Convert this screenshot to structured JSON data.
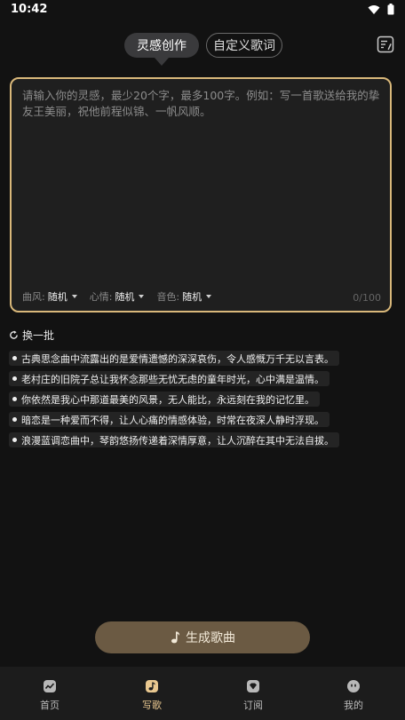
{
  "status_bar": {
    "time": "10:42"
  },
  "tabs": [
    {
      "label": "灵感创作",
      "active": true
    },
    {
      "label": "自定义歌词",
      "active": false
    }
  ],
  "editor": {
    "placeholder": "请输入你的灵感，最少20个字，最多100字。例如：写一首歌送给我的挚友王美丽，祝他前程似锦、一帆风顺。",
    "value": "",
    "char_count": "0/100",
    "options": [
      {
        "label": "曲风:",
        "value": "随机"
      },
      {
        "label": "心情:",
        "value": "随机"
      },
      {
        "label": "音色:",
        "value": "随机"
      }
    ]
  },
  "refresh_label": "换一批",
  "suggestions": [
    "古典思念曲中流露出的是爱情遗憾的深深哀伤，令人感慨万千无以言表。",
    "老村庄的旧院子总让我怀念那些无忧无虑的童年时光，心中满是温情。",
    "你依然是我心中那道最美的风景，无人能比，永远刻在我的记忆里。",
    "暗恋是一种爱而不得，让人心痛的情感体验，时常在夜深人静时浮现。",
    "浪漫蓝调恋曲中，琴韵悠扬传递着深情厚意，让人沉醉在其中无法自拔。"
  ],
  "generate_label": "生成歌曲",
  "nav": [
    {
      "label": "首页",
      "icon": "home-icon",
      "active": false
    },
    {
      "label": "写歌",
      "icon": "music-note-icon",
      "active": true
    },
    {
      "label": "订阅",
      "icon": "diamond-icon",
      "active": false
    },
    {
      "label": "我的",
      "icon": "profile-face-icon",
      "active": false
    }
  ],
  "colors": {
    "accent": "#d9b87a",
    "background": "#121212",
    "button": "#6b5a43",
    "nav_active": "#e9c890"
  }
}
